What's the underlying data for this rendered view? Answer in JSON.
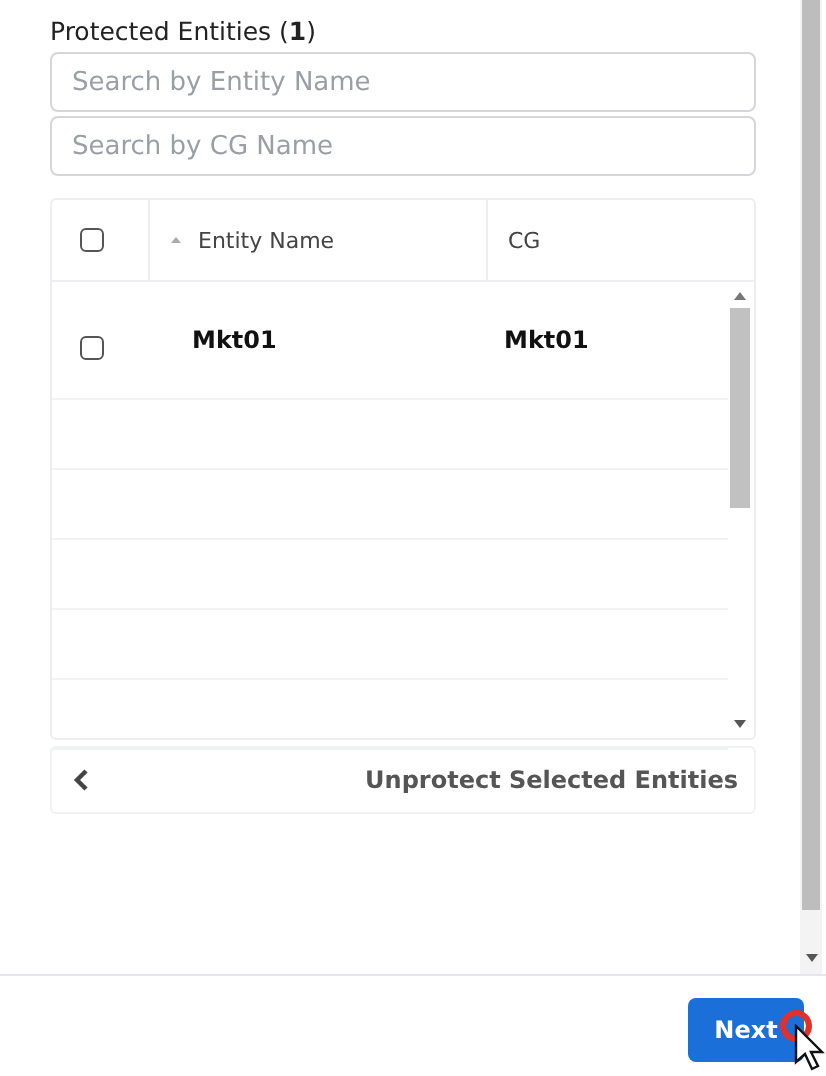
{
  "section": {
    "title": "Protected Entities (**1**)"
  },
  "search_fields": [
    {
      "placeholder": "Search by Entity Name"
    },
    {
      "placeholder": "Search by CG Name"
    }
  ],
  "table": {
    "header_checked": false,
    "columns": [
      {
        "label": "Entity Name",
        "sorted": true
      },
      {
        "label": "CG",
        "sorted": false
      }
    ],
    "rows": [
      {
        "checked": false,
        "cells": [
          "Mkt01",
          "Mkt01"
        ]
      }
    ]
  },
  "footer": {
    "action": "Unprotect Selected Entities"
  },
  "next_button": {
    "label": "Next"
  }
}
